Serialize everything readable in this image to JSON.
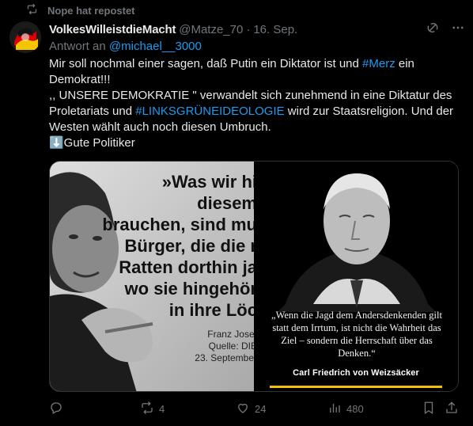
{
  "repost_banner": {
    "text": "Nope hat repostet"
  },
  "author": {
    "display_name": "VolkesWilleistdieMacht",
    "handle": "@Matze_70",
    "separator": "·",
    "date": "16. Sep."
  },
  "reply": {
    "prefix": "Antwort an",
    "target": "@michael__3000"
  },
  "tweet": {
    "line1_a": "Mir soll nochmal einer sagen, daß Putin ein Diktator ist und ",
    "line1_tag": "#Merz",
    "line1_b": " ein Demokrat!!!",
    "line2_a": ",, UNSERE DEMOKRATIE \" verwandelt sich zunehmend in eine Diktatur des Proletariats und ",
    "line2_tag": "#LINKSGRÜNEIDEOLOGIE",
    "line2_b": " wird zur Staatsreligion. Und der Westen wählt auch noch diesen Umbruch.",
    "line3": "⬇️Gute Politiker"
  },
  "media": {
    "left_quote_lines": [
      "»Was wir hi",
      "diesem",
      "brauchen, sind mu",
      "Bürger, die die r",
      "Ratten dorthin ja",
      "wo sie hingehör",
      "in ihre Löc"
    ],
    "left_credit_lines": [
      "Franz Josef",
      "Quelle: DIE",
      "23. September"
    ],
    "right_quote": "„Wenn die Jagd dem Andersdenkenden gilt statt dem Irrtum, ist nicht die Wahrheit das Ziel – sondern die Herrschaft über das Denken.“",
    "right_author": "Carl Friedrich von Weizsäcker"
  },
  "actions": {
    "reply_count": "",
    "repost_count": "4",
    "like_count": "24",
    "view_count": "480"
  },
  "colors": {
    "background": "#000000",
    "text": "#e7e9ea",
    "muted": "#71767b",
    "link": "#1d9bf0",
    "accent_bar": "#f2c200"
  },
  "icons": [
    "repost-icon",
    "grok-icon",
    "more-icon",
    "reply-icon",
    "like-icon",
    "views-icon",
    "bookmark-icon",
    "share-icon"
  ]
}
